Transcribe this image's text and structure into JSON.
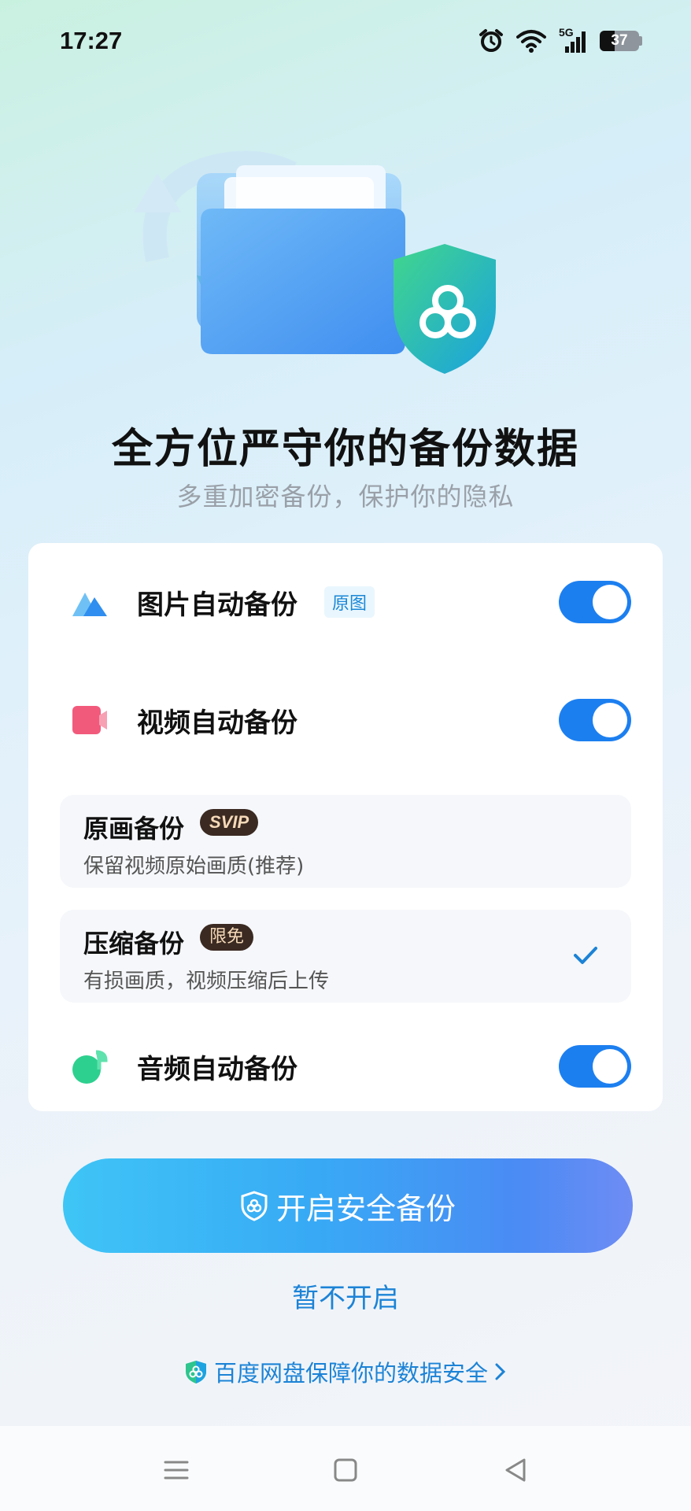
{
  "status_bar": {
    "time": "17:27",
    "network": "5G",
    "battery": "37"
  },
  "headline": "全方位严守你的备份数据",
  "subline": "多重加密备份，保护你的隐私",
  "options": {
    "photo": {
      "label": "图片自动备份",
      "tag": "原图",
      "enabled": true
    },
    "video": {
      "label": "视频自动备份",
      "enabled": true
    },
    "original": {
      "title": "原画备份",
      "badge": "SVIP",
      "desc": "保留视频原始画质(推荐)"
    },
    "compressed": {
      "title": "压缩备份",
      "badge": "限免",
      "desc": "有损画质，视频压缩后上传",
      "selected": true
    },
    "audio": {
      "label": "音频自动备份",
      "enabled": true
    }
  },
  "buttons": {
    "primary": "开启安全备份",
    "secondary": "暂不开启"
  },
  "footer_link": "百度网盘保障你的数据安全",
  "colors": {
    "accent": "#1c7ff0",
    "link": "#1c83d6"
  }
}
